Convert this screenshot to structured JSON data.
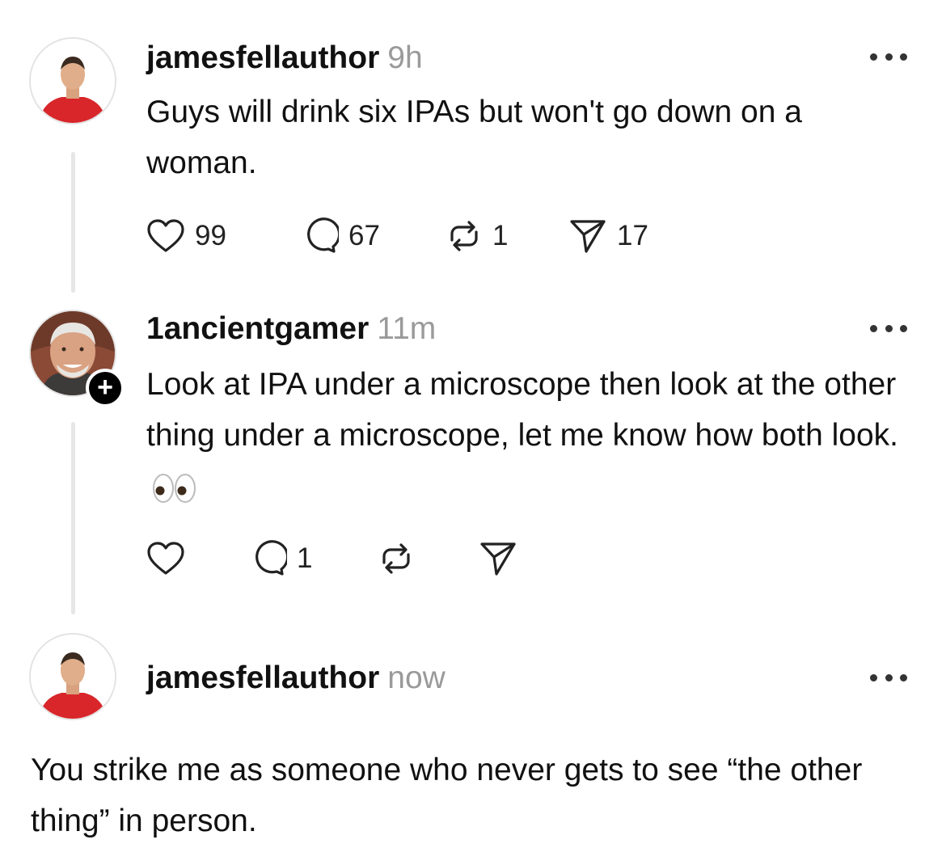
{
  "posts": [
    {
      "username": "jamesfellauthor",
      "time": "9h",
      "text": "Guys will drink six IPAs but won't go down on a woman.",
      "likes": "99",
      "replies": "67",
      "reposts": "1",
      "shares": "17"
    },
    {
      "username": "1ancientgamer",
      "time": "11m",
      "text": "Look at IPA under a microscope then look at the other thing under a microscope, let me know how both look.",
      "emoji": "eyes-icon",
      "replies": "1"
    },
    {
      "username": "jamesfellauthor",
      "time": "now",
      "text": "You strike me as someone who never gets to see “the other thing” in person."
    }
  ],
  "colors": {
    "timestamp": "#9a9a9a",
    "thread_line": "#e6e6e6",
    "shirt": "#d8262a"
  }
}
